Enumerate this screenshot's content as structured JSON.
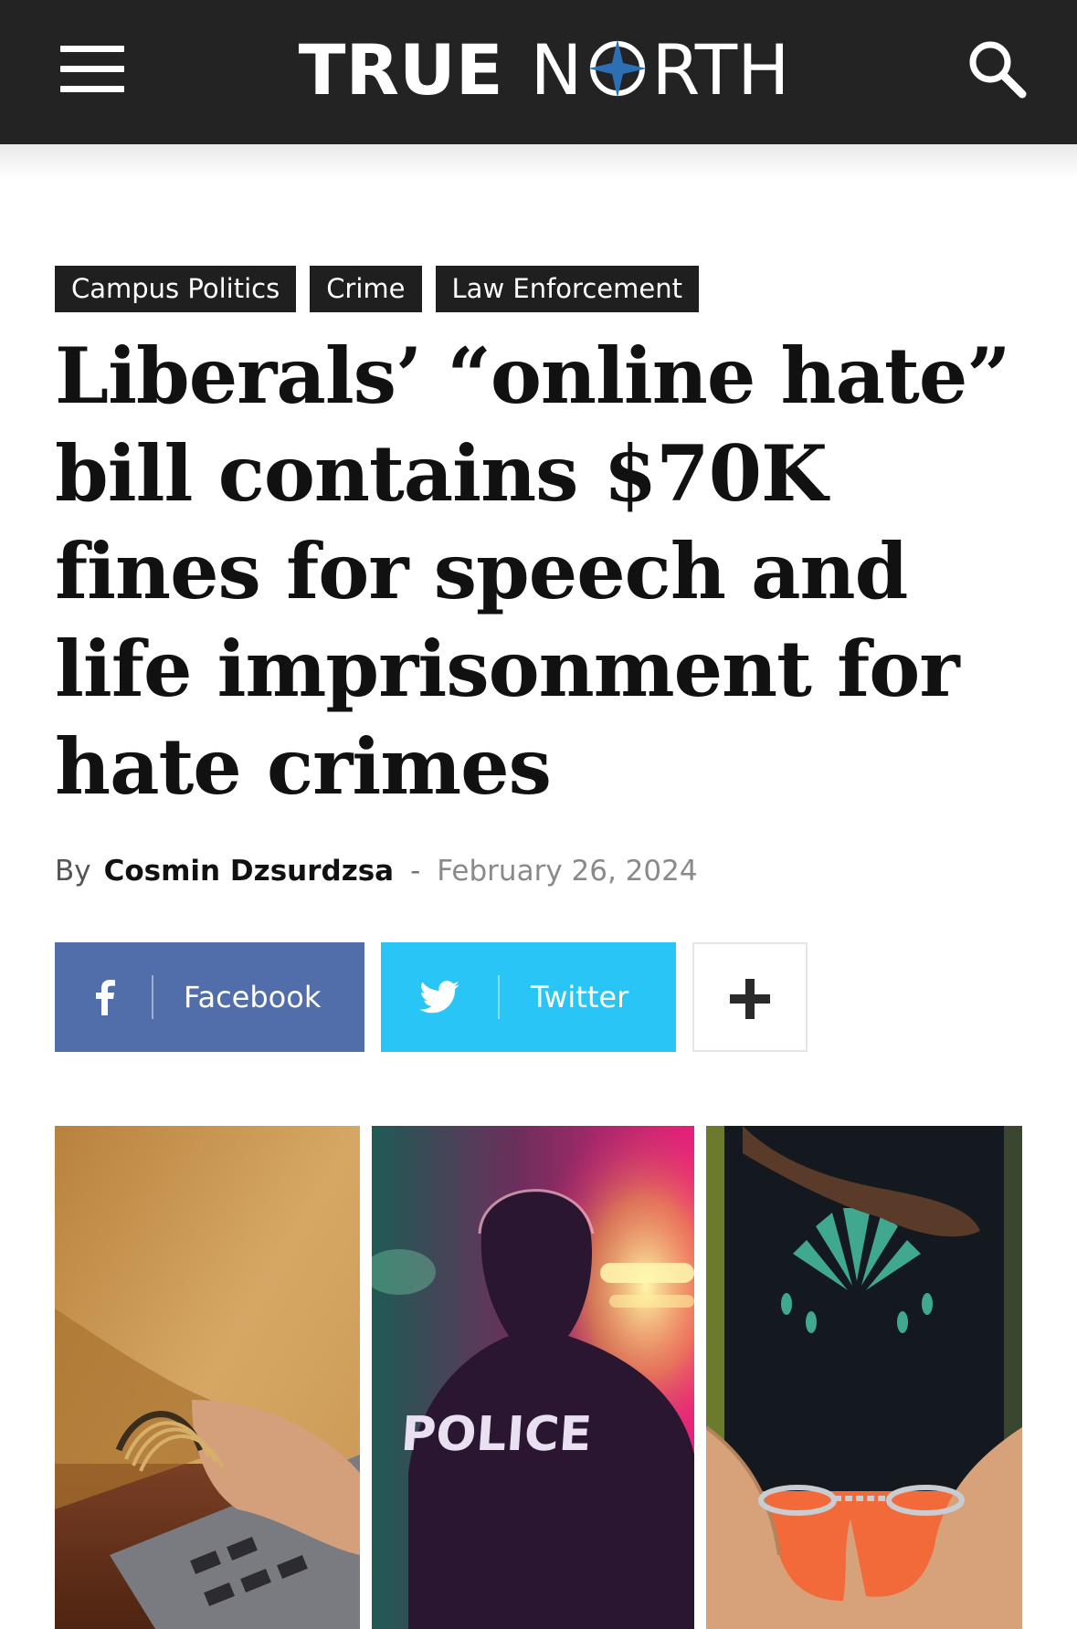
{
  "header": {
    "logo_word1": "TRUE",
    "logo_word2_start": "N",
    "logo_word2_end": "RTH",
    "colors": {
      "bar": "#232323",
      "logo_compass": "#2d6fb4"
    },
    "icons": {
      "menu": "menu-icon",
      "search": "search-icon"
    }
  },
  "categories": [
    "Campus Politics",
    "Crime",
    "Law Enforcement"
  ],
  "article": {
    "headline": "Liberals’ “online hate” bill contains $70K fines for speech and life imprisonment for hate crimes",
    "byline_prefix": "By",
    "author": "Cosmin Dzsurdzsa",
    "separator": "-",
    "date": "February 26, 2024"
  },
  "share": {
    "facebook_label": "Facebook",
    "twitter_label": "Twitter",
    "colors": {
      "facebook": "#516eab",
      "twitter": "#29c5f6"
    },
    "icons": {
      "facebook": "facebook-icon",
      "twitter": "twitter-icon",
      "more": "plus-icon"
    }
  },
  "image": {
    "police_text": "POLICE"
  }
}
